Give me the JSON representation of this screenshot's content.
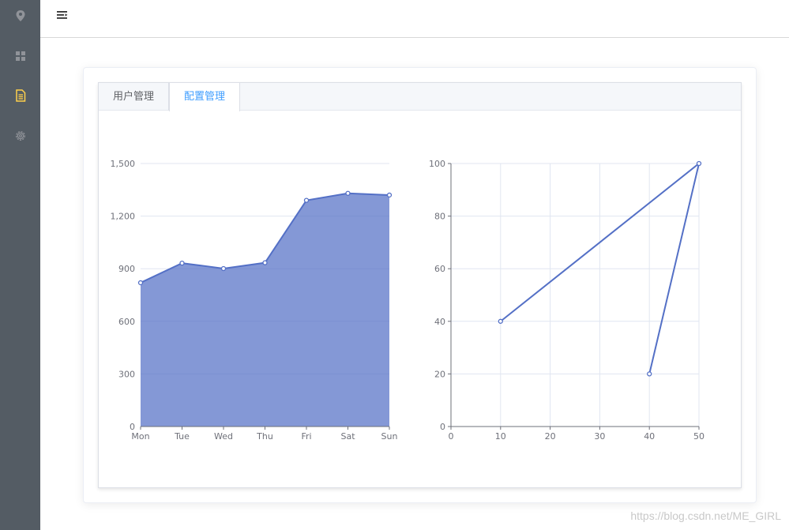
{
  "tabs": [
    {
      "label": "用户管理",
      "active": false
    },
    {
      "label": "配置管理",
      "active": true
    }
  ],
  "sidebar": {
    "items": [
      {
        "icon": "location-icon",
        "active": false
      },
      {
        "icon": "grid-icon",
        "active": false
      },
      {
        "icon": "document-icon",
        "active": true
      },
      {
        "icon": "gear-icon",
        "active": false
      }
    ],
    "active_color": "#ffd04b",
    "icon_color": "#909399"
  },
  "watermark": "https://blog.csdn.net/ME_GIRL",
  "chart_data": [
    {
      "type": "area",
      "categories": [
        "Mon",
        "Tue",
        "Wed",
        "Thu",
        "Fri",
        "Sat",
        "Sun"
      ],
      "values": [
        820,
        932,
        901,
        934,
        1290,
        1330,
        1320
      ],
      "ylim": [
        0,
        1500
      ],
      "yticks": [
        "0",
        "300",
        "600",
        "900",
        "1,200",
        "1,500"
      ],
      "grid": true,
      "color": "#5470c6"
    },
    {
      "type": "line",
      "points": [
        [
          10,
          40
        ],
        [
          50,
          100
        ],
        [
          40,
          20
        ]
      ],
      "xlim": [
        0,
        50
      ],
      "ylim": [
        0,
        100
      ],
      "xticks": [
        "0",
        "10",
        "20",
        "30",
        "40",
        "50"
      ],
      "yticks": [
        "0",
        "20",
        "40",
        "60",
        "80",
        "100"
      ],
      "grid": true,
      "color": "#5470c6"
    }
  ]
}
